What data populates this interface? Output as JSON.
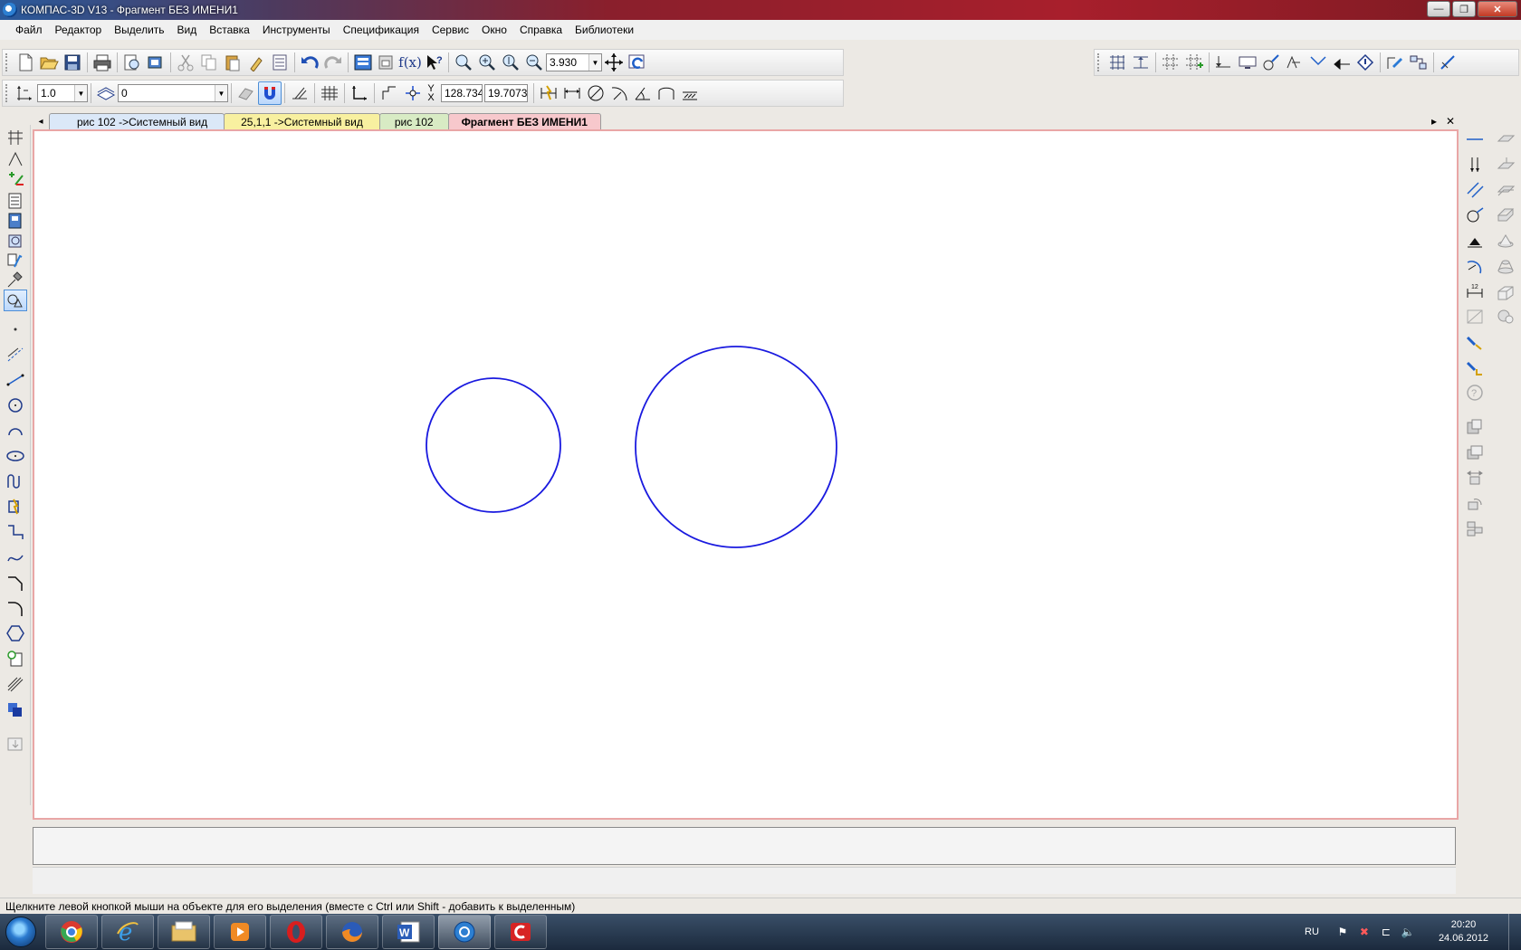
{
  "window": {
    "title": "КОМПАС-3D V13 - Фрагмент БЕЗ ИМЕНИ1",
    "minimize": "—",
    "maximize": "❐",
    "close": "✕"
  },
  "menu": [
    "Файл",
    "Редактор",
    "Выделить",
    "Вид",
    "Вставка",
    "Инструменты",
    "Спецификация",
    "Сервис",
    "Окно",
    "Справка",
    "Библиотеки"
  ],
  "toolbar": {
    "zoom_value": "3.930",
    "line_weight": "1.0",
    "layer_value": "0",
    "coord_y_label": "Y",
    "coord_x_label": "X",
    "coord_x_value": "128.734",
    "coord_y_value": "19.7073",
    "fx_label": "f(x)"
  },
  "tabs": [
    {
      "label": "рис 102 ->Системный вид",
      "color": "#dbe8f8"
    },
    {
      "label": "25,1,1 ->Системный вид",
      "color": "#f8f0a0"
    },
    {
      "label": "рис 102",
      "color": "#d8ebc4"
    },
    {
      "label": "Фрагмент БЕЗ ИМЕНИ1",
      "color": "#f7c8cc"
    }
  ],
  "tab_controls": {
    "next": "▸",
    "close": "✕",
    "prev": "◂"
  },
  "drawing": {
    "stroke_color": "#1a1adf"
  },
  "status": {
    "hint": "Щелкните левой кнопкой мыши на объекте для его выделения (вместе с Ctrl или Shift - добавить к выделенным)"
  },
  "taskbar": {
    "lang": "RU",
    "time": "20:20",
    "date": "24.06.2012"
  }
}
